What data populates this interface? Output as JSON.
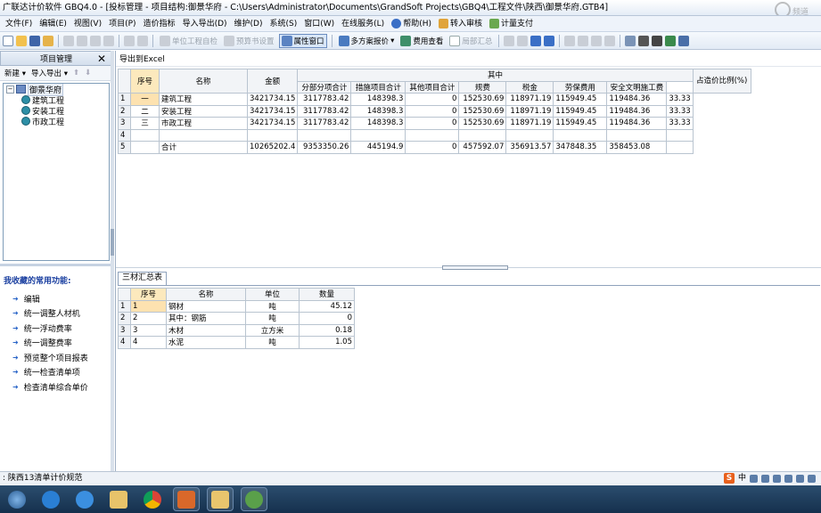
{
  "window": {
    "title": "广联达计价软件 GBQ4.0 - [投标管理 - 项目结构:御景华府 - C:\\Users\\Administrator\\Documents\\GrandSoft Projects\\GBQ4\\工程文件\\陕西\\御景华府.GTB4]",
    "watermark": "频道"
  },
  "menubar": {
    "items": [
      "文件(F)",
      "编辑(E)",
      "视图(V)",
      "项目(P)",
      "造价指标",
      "导入导出(D)",
      "维护(D)",
      "系统(S)",
      "窗口(W)",
      "在线服务(L)",
      "帮助(H)",
      "转入审核",
      "计量支付"
    ]
  },
  "toolbar": {
    "unit_self_check": "单位工程自检",
    "budget_settings": "预算书设置",
    "property_window": "属性窗口",
    "multi_scheme": "多方案报价",
    "fee_view": "费用查看",
    "partial_summary": "局部汇总"
  },
  "left_panel": {
    "title": "项目管理",
    "close": "✕",
    "new_label": "新建",
    "import_export_label": "导入导出",
    "tree_root": "御景华府",
    "tree_children": [
      "建筑工程",
      "安装工程",
      "市政工程"
    ],
    "favorites_title": "我收藏的常用功能:",
    "favorites": [
      "编辑",
      "统一调整人材机",
      "统一浮动费率",
      "统一调整费率",
      "预览整个项目报表",
      "统一检查清单项",
      "检查清单综合单价"
    ]
  },
  "main": {
    "export_excel": "导出到Excel",
    "headers": {
      "seq": "序号",
      "name": "名称",
      "amount": "金额",
      "group": "其中",
      "sub_items": "分部分项合计",
      "measures": "措施项目合计",
      "other": "其他项目合计",
      "fees": "规费",
      "tax": "税金",
      "labor": "劳保费用",
      "safety": "安全文明施工费",
      "ratio": "占造价比例(%)"
    },
    "rows": [
      {
        "rn": "1",
        "seq": "一",
        "name": "建筑工程",
        "amount": "3421734.15",
        "sub": "3117783.42",
        "measures": "148398.3",
        "other": "0",
        "fees": "152530.69",
        "tax": "118971.19",
        "labor": "115949.45",
        "safety": "119484.36",
        "ratio": "33.33"
      },
      {
        "rn": "2",
        "seq": "二",
        "name": "安装工程",
        "amount": "3421734.15",
        "sub": "3117783.42",
        "measures": "148398.3",
        "other": "0",
        "fees": "152530.69",
        "tax": "118971.19",
        "labor": "115949.45",
        "safety": "119484.36",
        "ratio": "33.33"
      },
      {
        "rn": "3",
        "seq": "三",
        "name": "市政工程",
        "amount": "3421734.15",
        "sub": "3117783.42",
        "measures": "148398.3",
        "other": "0",
        "fees": "152530.69",
        "tax": "118971.19",
        "labor": "115949.45",
        "safety": "119484.36",
        "ratio": "33.33"
      },
      {
        "rn": "4",
        "seq": "",
        "name": "",
        "amount": "",
        "sub": "",
        "measures": "",
        "other": "",
        "fees": "",
        "tax": "",
        "labor": "",
        "safety": "",
        "ratio": ""
      },
      {
        "rn": "5",
        "seq": "",
        "name": "合计",
        "amount": "10265202.4",
        "sub": "9353350.26",
        "measures": "445194.9",
        "other": "0",
        "fees": "457592.07",
        "tax": "356913.57",
        "labor": "347848.35",
        "safety": "358453.08",
        "ratio": ""
      }
    ],
    "tab": "三材汇总表",
    "materials_headers": {
      "seq": "序号",
      "name": "名称",
      "unit": "单位",
      "qty": "数量"
    },
    "materials": [
      {
        "rn": "1",
        "seq": "1",
        "name": "钢材",
        "unit": "吨",
        "qty": "45.12"
      },
      {
        "rn": "2",
        "seq": "2",
        "name": "其中：钢筋",
        "unit": "吨",
        "qty": "0"
      },
      {
        "rn": "3",
        "seq": "3",
        "name": "木材",
        "unit": "立方米",
        "qty": "0.18"
      },
      {
        "rn": "4",
        "seq": "4",
        "name": "水泥",
        "unit": "吨",
        "qty": "1.05"
      }
    ]
  },
  "statusbar": {
    "text": ": 陕西13清单计价规范",
    "ime_badge": "S",
    "ime_lang": "中"
  },
  "colors": {
    "selected_seq": "#fde2b0",
    "header_bg": "#f2f4f7",
    "taskbar": "#1d3a5a"
  }
}
